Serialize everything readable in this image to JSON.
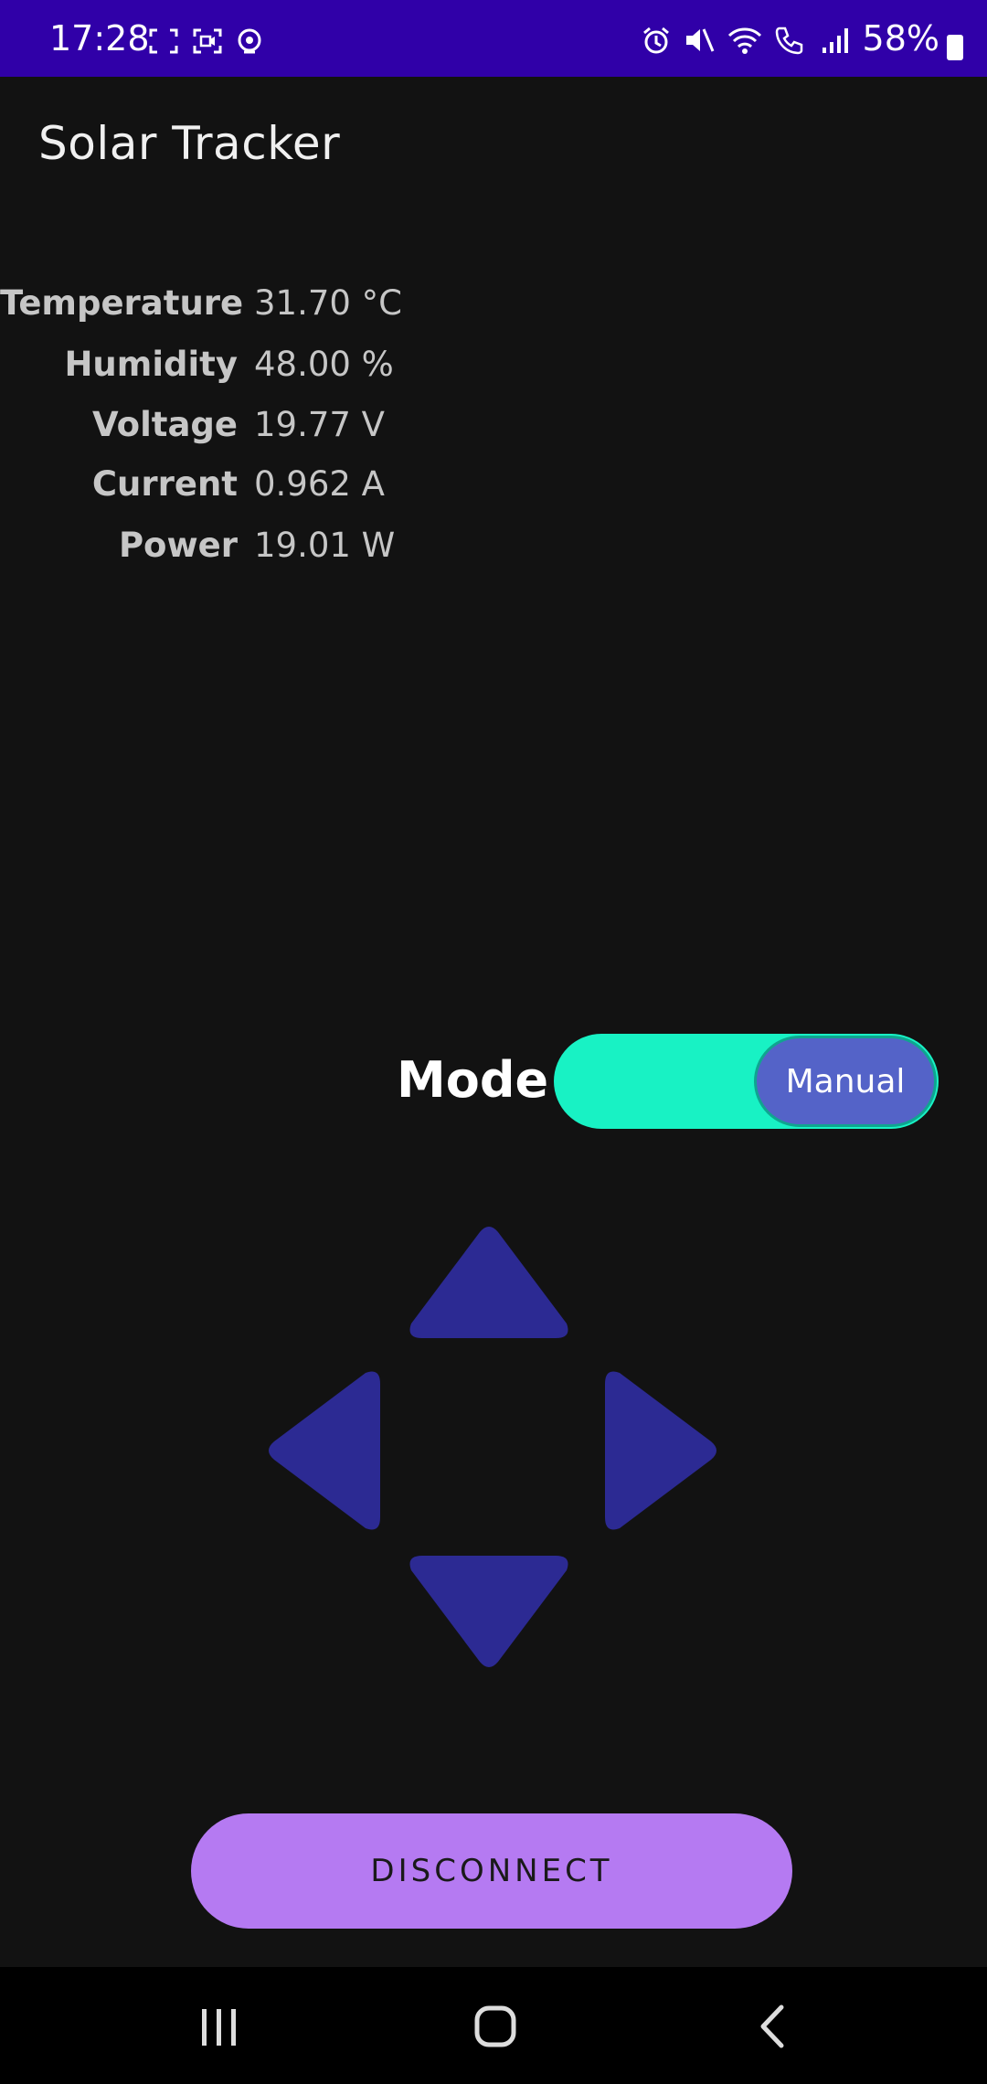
{
  "status_bar": {
    "time": "17:28",
    "battery_percent": "58%"
  },
  "app": {
    "title": "Solar Tracker"
  },
  "readings": [
    {
      "label": "Temperature",
      "value": "31.70 °C"
    },
    {
      "label": "Humidity",
      "value": "48.00 %"
    },
    {
      "label": "Voltage",
      "value": "19.77 V"
    },
    {
      "label": "Current",
      "value": "0.962 A"
    },
    {
      "label": "Power",
      "value": "19.01 W"
    }
  ],
  "mode": {
    "label": "Mode",
    "switch_state": "Manual"
  },
  "dpad": {
    "color": "#2c2a93"
  },
  "actions": {
    "disconnect_label": "DISCONNECT"
  },
  "colors": {
    "status_bar": "#3000a8",
    "background": "#121212",
    "switch_track": "#18f2c4",
    "switch_thumb": "#5463c8",
    "disconnect_button": "#b57af2"
  },
  "icons": {
    "status_left": [
      "screenshot-icon",
      "screen-record-icon",
      "hotspot-icon"
    ],
    "status_right": [
      "alarm-icon",
      "mute-icon",
      "wifi-icon",
      "call-icon",
      "signal-icon",
      "battery-icon"
    ],
    "nav": [
      "recent-apps-icon",
      "home-icon",
      "back-icon"
    ],
    "dpad": [
      "arrow-up-icon",
      "arrow-left-icon",
      "arrow-right-icon",
      "arrow-down-icon"
    ]
  }
}
